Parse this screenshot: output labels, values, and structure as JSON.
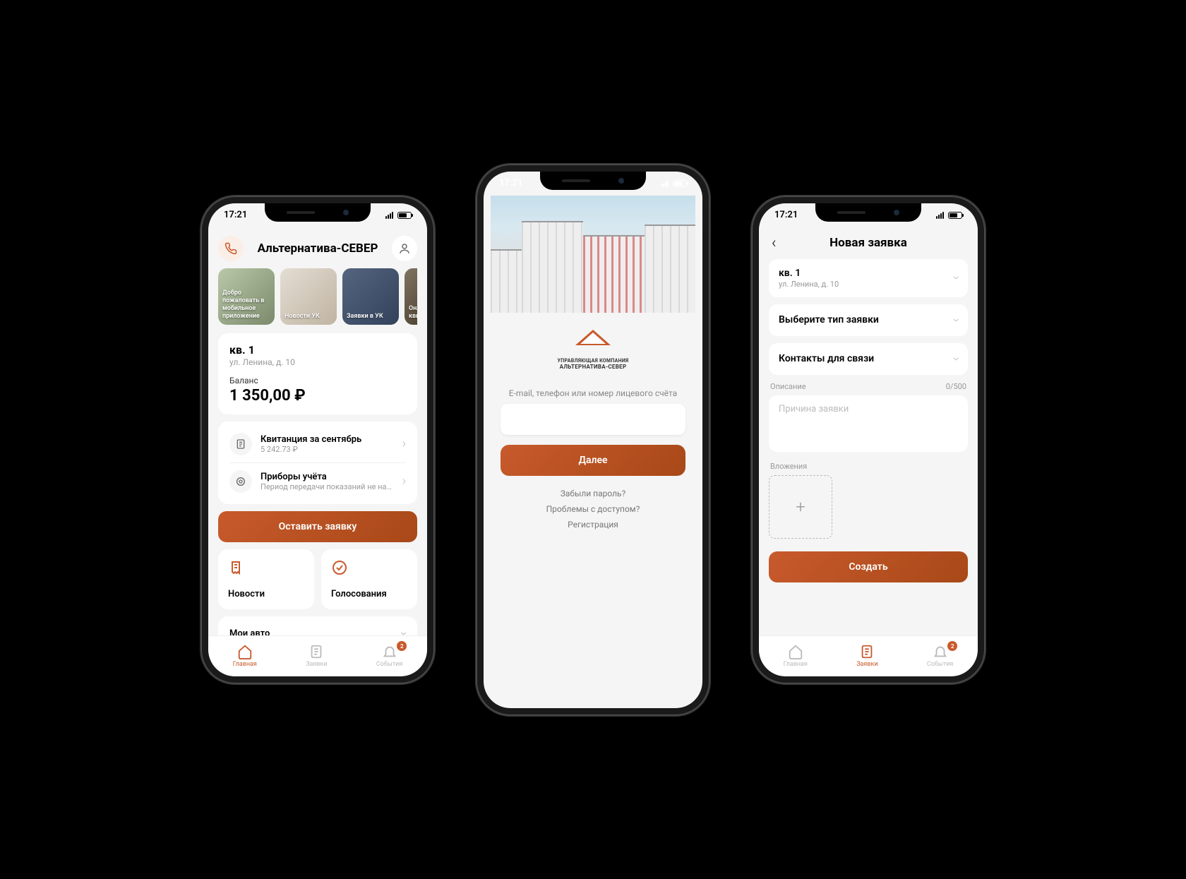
{
  "status_time": "17:21",
  "phone1": {
    "title": "Альтернатива-СЕВЕР",
    "stories": [
      {
        "label": "Добро пожаловать в мобильное приложение"
      },
      {
        "label": "Новости УК"
      },
      {
        "label": "Заявки в УК"
      },
      {
        "label": "Онл квит"
      }
    ],
    "apartment": {
      "title": "кв. 1",
      "address": "ул. Ленина, д. 10"
    },
    "balance_label": "Баланс",
    "balance_value": "1 350,00 ₽",
    "rows": [
      {
        "title": "Квитанция за сентябрь",
        "sub": "5 242.73 ₽"
      },
      {
        "title": "Приборы учёта",
        "sub": "Период передачи показаний не наст..."
      }
    ],
    "btn_request": "Оставить заявку",
    "card_news": "Новости",
    "card_votes": "Голосования",
    "card_cars": "Мои авто",
    "tabs": [
      {
        "label": "Главная",
        "active": true
      },
      {
        "label": "Заявки"
      },
      {
        "label": "События",
        "badge": "2"
      }
    ]
  },
  "phone2": {
    "logo_line1": "УПРАВЛЯЮЩАЯ КОМПАНИЯ",
    "logo_line2": "АЛЬТЕРНАТИВА-СЕВЕР",
    "login_label": "E-mail, телефон или номер лицевого счёта",
    "btn_next": "Далее",
    "links": [
      "Забыли пароль?",
      "Проблемы с доступом?",
      "Регистрация"
    ]
  },
  "phone3": {
    "title": "Новая заявка",
    "apartment": {
      "title": "кв. 1",
      "address": "ул. Ленина, д. 10"
    },
    "select_type": "Выберите тип заявки",
    "contacts": "Контакты для связи",
    "desc_label": "Описание",
    "desc_counter": "0/500",
    "desc_placeholder": "Причина заявки",
    "attach_label": "Вложения",
    "btn_create": "Создать",
    "tabs": [
      {
        "label": "Главная"
      },
      {
        "label": "Заявки",
        "active": true
      },
      {
        "label": "События",
        "badge": "2"
      }
    ]
  }
}
